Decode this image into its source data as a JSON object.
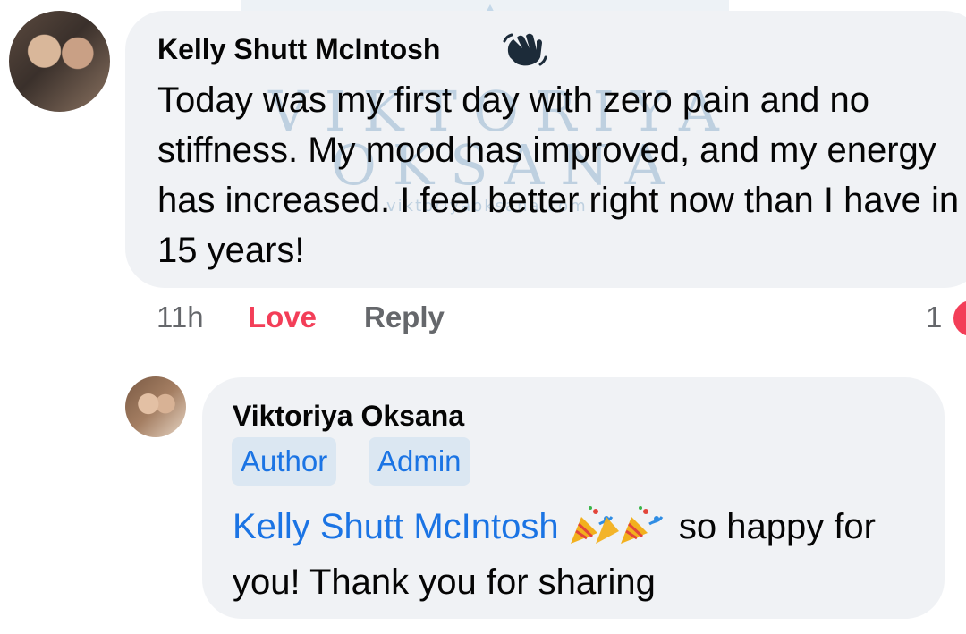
{
  "watermark": {
    "line1": "VIKTORIYA",
    "line2": "OKSANA",
    "line3": "viktoriyaoksana.com"
  },
  "comment": {
    "author": "Kelly Shutt McIntosh",
    "author_icon": "wave-hand-icon",
    "text": "Today was my first day with zero pain and no stiffness. My mood has improved, and my energy has increased. I feel better right now than I have in 15 years!",
    "time": "11h",
    "reaction_label": "Love",
    "reply_label": "Reply",
    "reaction_count": "1"
  },
  "reply": {
    "author": "Viktoriya Oksana",
    "badges": [
      "Author",
      "Admin"
    ],
    "mention": "Kelly Shutt McIntosh",
    "emoji": "party-popper-icon",
    "text": "so happy for you! Thank you for sharing"
  },
  "colors": {
    "bubble": "#f0f2f5",
    "love": "#f33e58",
    "link": "#1b74e4",
    "badge_bg": "#dbe7f2",
    "meta": "#65676b"
  }
}
